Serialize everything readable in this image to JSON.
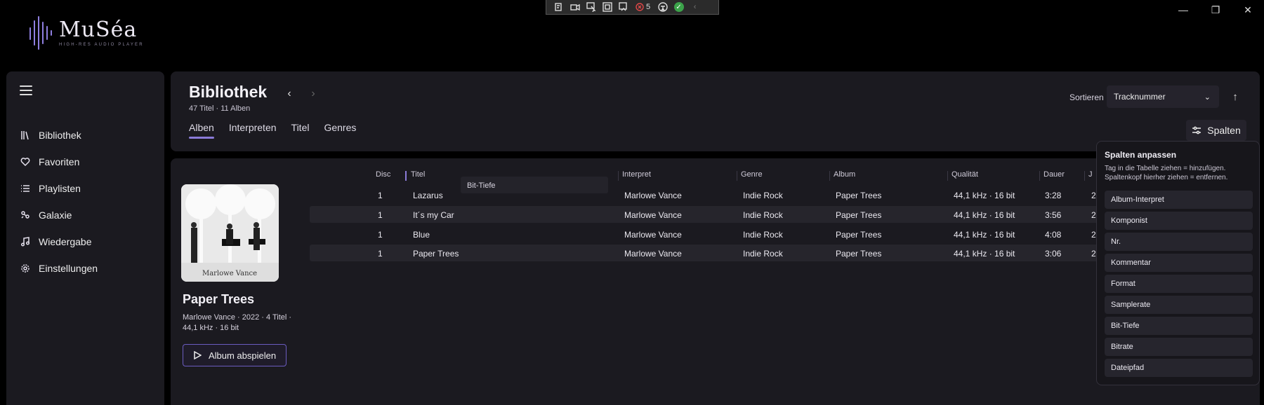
{
  "window": {
    "devtools_count": "5"
  },
  "app": {
    "name": "MuSéa",
    "tagline": "HIGH-RES AUDIO PLAYER"
  },
  "sidebar": {
    "items": [
      {
        "label": "Bibliothek",
        "icon": "library-icon"
      },
      {
        "label": "Favoriten",
        "icon": "heart-icon"
      },
      {
        "label": "Playlisten",
        "icon": "list-icon"
      },
      {
        "label": "Galaxie",
        "icon": "galaxy-icon"
      },
      {
        "label": "Wiedergabe",
        "icon": "music-note-icon"
      },
      {
        "label": "Einstellungen",
        "icon": "gear-icon"
      }
    ]
  },
  "header": {
    "title": "Bibliothek",
    "subtitle": "47 Titel · 11 Alben",
    "tabs": [
      {
        "label": "Alben",
        "active": true
      },
      {
        "label": "Interpreten",
        "active": false
      },
      {
        "label": "Titel",
        "active": false
      },
      {
        "label": "Genres",
        "active": false
      }
    ],
    "sort_label": "Sortieren",
    "sort_value": "Tracknummer",
    "columns_button": "Spalten"
  },
  "album": {
    "cover_caption": "Marlowe Vance",
    "title": "Paper Trees",
    "meta": "Marlowe Vance · 2022 · 4 Titel · 44,1 kHz · 16 bit",
    "play_button": "Album abspielen"
  },
  "table": {
    "columns": [
      "Disc",
      "Titel",
      "Interpret",
      "Genre",
      "Album",
      "Qualität",
      "Dauer",
      "J"
    ],
    "drag_ghost": "Bit-Tiefe",
    "rows": [
      {
        "disc": "1",
        "title": "Lazarus",
        "artist": "Marlowe Vance",
        "genre": "Indie Rock",
        "album": "Paper Trees",
        "quality": "44,1 kHz · 16 bit",
        "duration": "3:28",
        "year": "2"
      },
      {
        "disc": "1",
        "title": "It´s my Car",
        "artist": "Marlowe Vance",
        "genre": "Indie Rock",
        "album": "Paper Trees",
        "quality": "44,1 kHz · 16 bit",
        "duration": "3:56",
        "year": "2"
      },
      {
        "disc": "1",
        "title": "Blue",
        "artist": "Marlowe Vance",
        "genre": "Indie Rock",
        "album": "Paper Trees",
        "quality": "44,1 kHz · 16 bit",
        "duration": "4:08",
        "year": "2"
      },
      {
        "disc": "1",
        "title": "Paper Trees",
        "artist": "Marlowe Vance",
        "genre": "Indie Rock",
        "album": "Paper Trees",
        "quality": "44,1 kHz · 16 bit",
        "duration": "3:06",
        "year": "2"
      }
    ]
  },
  "columns_panel": {
    "heading": "Spalten anpassen",
    "description": "Tag in die Tabelle ziehen = hinzufügen. Spaltenkopf hierher ziehen = entfernen.",
    "available": [
      "Album-Interpret",
      "Komponist",
      "Nr.",
      "Kommentar",
      "Format",
      "Samplerate",
      "Bit-Tiefe",
      "Bitrate",
      "Dateipfad"
    ]
  },
  "colors": {
    "accent": "#8b7bd8",
    "panel": "#1b1a20",
    "background": "#000000"
  }
}
